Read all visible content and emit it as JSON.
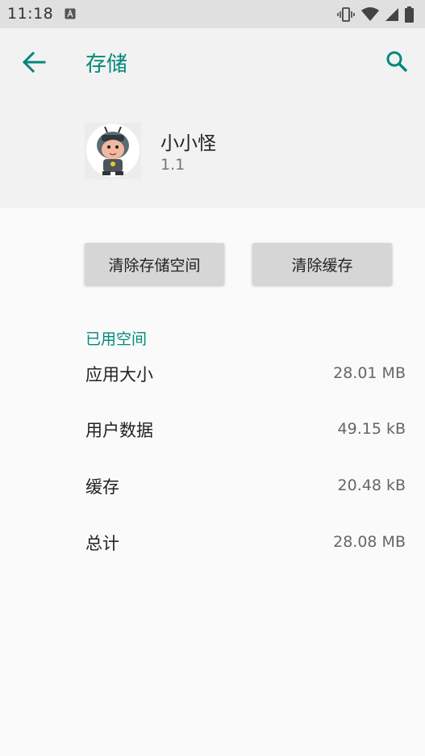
{
  "status_bar": {
    "time": "11:18",
    "notification_icon": "a-letter-icon",
    "icons": [
      "vibrate-icon",
      "wifi-icon",
      "signal-icon",
      "battery-icon"
    ]
  },
  "header": {
    "title": "存储",
    "back_icon": "arrow-back-icon",
    "search_icon": "search-icon"
  },
  "app": {
    "name": "小小怪",
    "version": "1.1"
  },
  "actions": {
    "clear_storage": "清除存储空间",
    "clear_cache": "清除缓存"
  },
  "usage": {
    "section_title": "已用空间",
    "rows": [
      {
        "label": "应用大小",
        "value": "28.01 MB"
      },
      {
        "label": "用户数据",
        "value": "49.15 kB"
      },
      {
        "label": "缓存",
        "value": "20.48 kB"
      },
      {
        "label": "总计",
        "value": "28.08 MB"
      }
    ]
  },
  "colors": {
    "accent": "#00897b",
    "header_bg": "#f2f2f2",
    "page_bg": "#fafafa",
    "button_bg": "#d6d6d6"
  }
}
